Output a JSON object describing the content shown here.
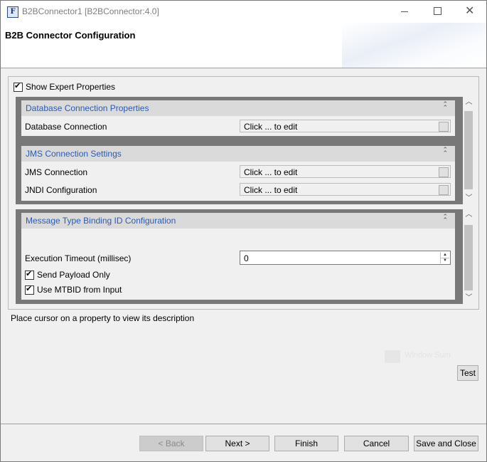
{
  "window": {
    "title": "B2BConnector1 [B2BConnector:4.0]",
    "app_icon_letter": "F",
    "icons": [
      "minimize-icon",
      "maximize-icon",
      "close-icon"
    ]
  },
  "header": {
    "title": "B2B Connector Configuration"
  },
  "expert": {
    "label": "Show Expert Properties",
    "checked": true
  },
  "sections": {
    "db": {
      "title": "Database Connection Properties",
      "rows": [
        {
          "label": "Database Connection",
          "value": "Click ... to edit"
        }
      ]
    },
    "jms": {
      "title": "JMS Connection Settings",
      "rows": [
        {
          "label": "JMS Connection",
          "value": "Click ... to edit"
        },
        {
          "label": "JNDI Configuration",
          "value": "Click ... to edit"
        }
      ]
    },
    "mtb": {
      "title": "Message Type Binding ID Configuration",
      "timeout_label": "Execution Timeout (millisec)",
      "timeout_value": "0",
      "send_payload_label": "Send Payload Only",
      "send_payload_checked": true,
      "use_mtbid_label": "Use MTBID from Input",
      "use_mtbid_checked": true
    }
  },
  "description": "Place cursor on a property to view its description",
  "watermark_text": "Window Sum",
  "buttons": {
    "test": "Test",
    "back": "< Back",
    "next": "Next >",
    "finish": "Finish",
    "cancel": "Cancel",
    "save_close": "Save and Close"
  },
  "colors": {
    "section_title": "#2a5bb5",
    "section_header_bg": "#dadada",
    "group_border": "#787878"
  }
}
